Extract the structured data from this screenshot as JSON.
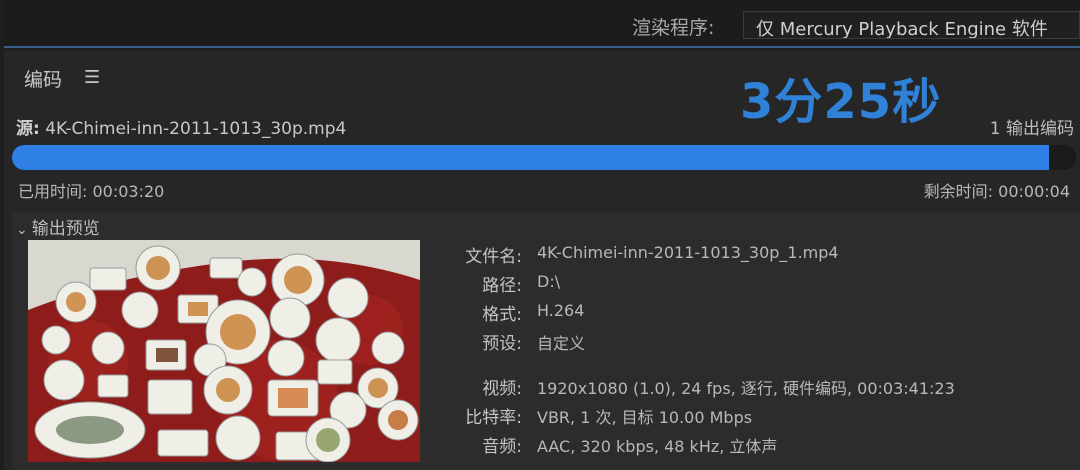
{
  "header": {
    "renderer_label": "渲染程序:",
    "renderer_value": "仅 Mercury Playback Engine 软件"
  },
  "panel": {
    "title": "编码",
    "menu_icon": "hamburger-menu-icon",
    "timer_overlay": "3分25秒",
    "source_prefix": "源:",
    "source_file": "4K-Chimei-inn-2011-1013_30p.mp4",
    "output_count": "1 输出编码",
    "progress": 0.975,
    "elapsed": "已用时间: 00:03:20",
    "remaining": "剩余时间: 00:00:04",
    "colors": {
      "accent": "#2f80e6",
      "timer": "#2f82d8"
    }
  },
  "preview": {
    "header": "输出预览",
    "chevron_icon": "chevron-down-icon",
    "thumbnail_icon": "video-thumbnail",
    "fields": [
      {
        "label": "文件名:",
        "value": "4K-Chimei-inn-2011-1013_30p_1.mp4"
      },
      {
        "label": "路径:",
        "value": "D:\\"
      },
      {
        "label": "格式:",
        "value": "H.264"
      },
      {
        "label": "预设:",
        "value": "自定义"
      },
      {
        "label": "视频:",
        "value": "1920x1080 (1.0), 24 fps, 逐行, 硬件编码, 00:03:41:23"
      },
      {
        "label": "比特率:",
        "value": "VBR, 1 次, 目标 10.00 Mbps"
      },
      {
        "label": "音频:",
        "value": "AAC, 320 kbps, 48 kHz, 立体声"
      }
    ]
  }
}
